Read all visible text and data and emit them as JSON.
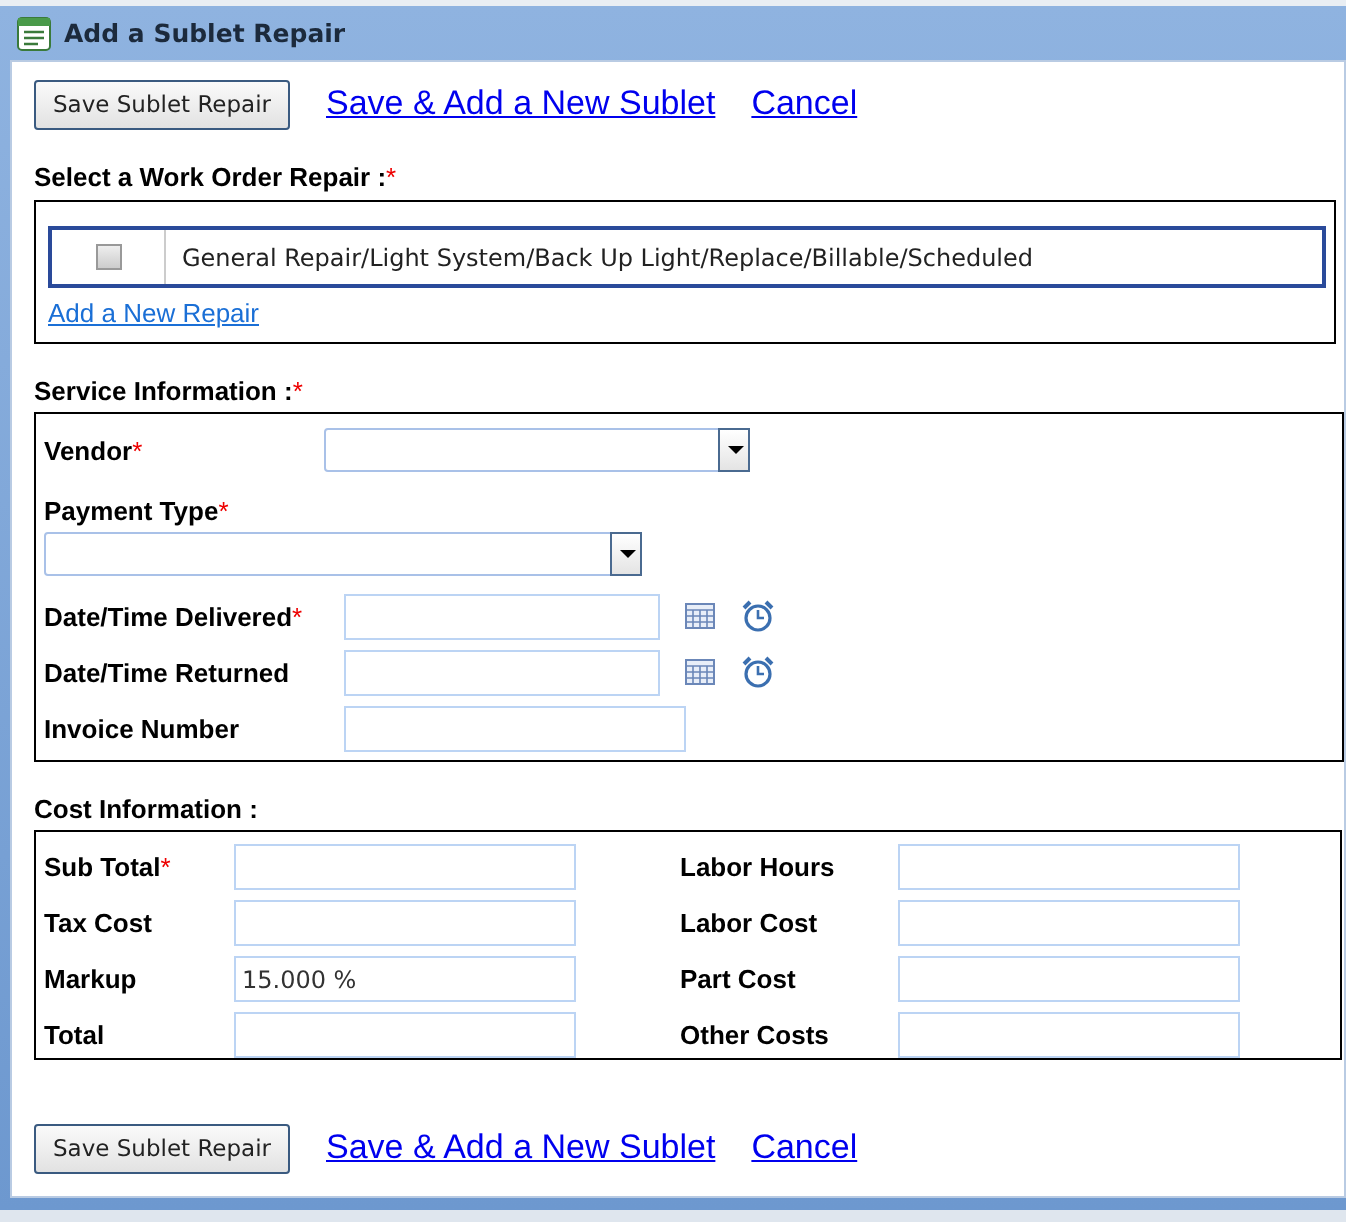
{
  "window": {
    "title": "Add a Sublet Repair"
  },
  "required_mark": "*",
  "actions_top": {
    "button": "Save Sublet Repair",
    "links": [
      "Save & Add a New Sublet",
      "Cancel"
    ]
  },
  "repair_section": {
    "heading": "Select a Work Order Repair :",
    "required": true,
    "add_link": "Add a New Repair",
    "repairs": [
      {
        "label": "General Repair/Light System/Back Up Light/Replace/Billable/Scheduled",
        "checked": false
      }
    ]
  },
  "service_section": {
    "heading": "Service Information :",
    "required": true,
    "fields": [
      {
        "kind": "dropdown",
        "label": "Vendor",
        "required": true
      },
      {
        "kind": "dropdown_stacked",
        "label": "Payment Type",
        "required": true
      },
      {
        "kind": "datetime",
        "label": "Date/Time Delivered",
        "required": true
      },
      {
        "kind": "datetime",
        "label": "Date/Time Returned",
        "required": false
      },
      {
        "kind": "text",
        "label": "Invoice Number",
        "required": false
      }
    ]
  },
  "cost_section": {
    "heading": "Cost Information :",
    "required": false,
    "left": [
      {
        "label": "Sub Total",
        "required": true
      },
      {
        "label": "Tax Cost",
        "required": false
      },
      {
        "label": "Markup",
        "required": false,
        "value": "15.000 %"
      },
      {
        "label": "Total",
        "required": false
      }
    ],
    "right": [
      {
        "label": "Labor Hours",
        "required": false
      },
      {
        "label": "Labor Cost",
        "required": false
      },
      {
        "label": "Part Cost",
        "required": false
      },
      {
        "label": "Other Costs",
        "required": false
      }
    ]
  },
  "actions_bottom": {
    "button": "Save Sublet Repair",
    "links": [
      "Save & Add a New Sublet",
      "Cancel"
    ]
  }
}
